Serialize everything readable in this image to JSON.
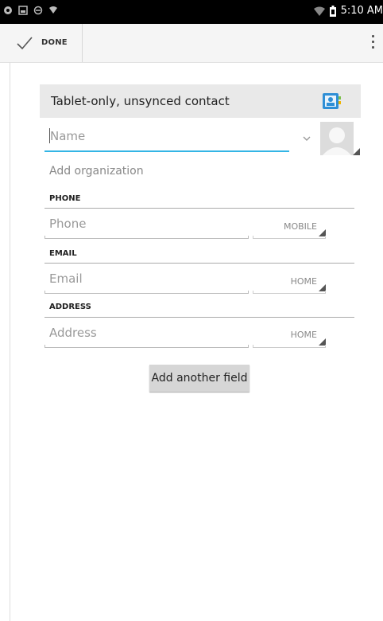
{
  "status_bar": {
    "time": "5:10 AM",
    "icons": [
      "notification-icon",
      "gallery-icon",
      "sync-icon",
      "wifi-icon",
      "battery-icon"
    ]
  },
  "action_bar": {
    "done_label": "DONE",
    "icons": [
      "checkmark-icon",
      "overflow-menu-icon"
    ]
  },
  "contact": {
    "header_title": "Tablet-only, unsynced contact",
    "name_placeholder": "Name",
    "organization_label": "Add organization"
  },
  "sections": [
    {
      "title": "PHONE",
      "placeholder": "Phone",
      "type": "MOBILE"
    },
    {
      "title": "EMAIL",
      "placeholder": "Email",
      "type": "HOME"
    },
    {
      "title": "ADDRESS",
      "placeholder": "Address",
      "type": "HOME"
    }
  ],
  "add_field_label": "Add another field",
  "colors": {
    "accent": "#33b5e5",
    "status_bar": "#000000",
    "header_bg": "#e9e9e9",
    "button_bg": "#d6d6d6"
  }
}
